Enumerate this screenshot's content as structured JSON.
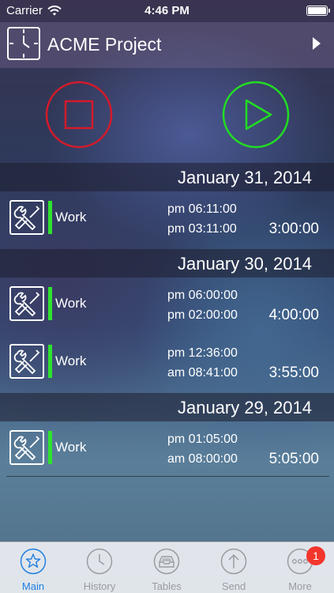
{
  "status_bar": {
    "carrier": "Carrier",
    "time": "4:46 PM"
  },
  "nav": {
    "title": "ACME Project"
  },
  "colors": {
    "stop": "#d41a2a",
    "play": "#22dd22",
    "category": "#2fe22f",
    "tab_active": "#1f7fe0",
    "badge": "#f2352d"
  },
  "sections": [
    {
      "date": "January 31, 2014"
    },
    {
      "date": "January 30, 2014"
    },
    {
      "date": "January 29, 2014"
    }
  ],
  "entries": [
    {
      "label": "Work",
      "start": "pm 06:11:00",
      "end": "pm 03:11:00",
      "duration": "3:00:00"
    },
    {
      "label": "Work",
      "start": "pm 06:00:00",
      "end": "pm 02:00:00",
      "duration": "4:00:00"
    },
    {
      "label": "Work",
      "start": "pm 12:36:00",
      "end": "am 08:41:00",
      "duration": "3:55:00"
    },
    {
      "label": "Work",
      "start": "pm 01:05:00",
      "end": "am 08:00:00",
      "duration": "5:05:00"
    }
  ],
  "tabs": [
    {
      "label": "Main",
      "icon": "star-icon",
      "active": true
    },
    {
      "label": "History",
      "icon": "clock-icon"
    },
    {
      "label": "Tables",
      "icon": "tray-icon"
    },
    {
      "label": "Send",
      "icon": "upload-icon"
    },
    {
      "label": "More",
      "icon": "more-icon",
      "badge": "1"
    }
  ]
}
